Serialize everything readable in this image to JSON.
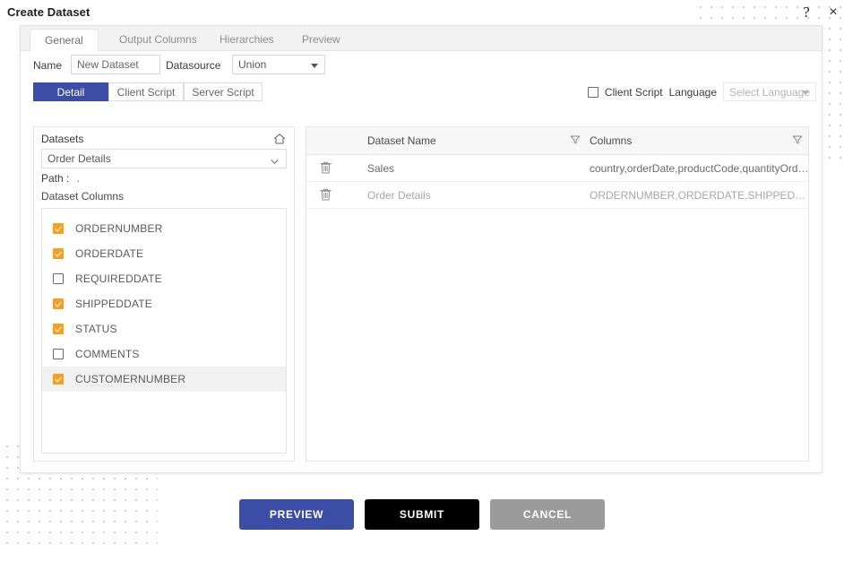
{
  "window": {
    "title": "Create Dataset",
    "help_icon": "question-mark-icon",
    "help_label": "?",
    "close_label": "×"
  },
  "colors": {
    "accent_blue": "#3b4da4",
    "checkbox_orange": "#f5a020",
    "submit_black": "#000000",
    "cancel_gray": "#9b9b9b",
    "dot_pattern": "#c9c9e8"
  },
  "tabs": [
    {
      "label": "General",
      "active": true
    },
    {
      "label": "Output Columns",
      "active": false
    },
    {
      "label": "Hierarchies",
      "active": false
    },
    {
      "label": "Preview",
      "active": false
    }
  ],
  "fields": {
    "name_label": "Name",
    "name_value": "New Dataset",
    "name_placeholder": "New Dataset",
    "datasource_label": "Datasource",
    "datasource_value": "Union"
  },
  "subtabs": [
    {
      "label": "Detail",
      "active": true
    },
    {
      "label": "Client Script",
      "active": false
    },
    {
      "label": "Server Script",
      "active": false
    }
  ],
  "script_options": {
    "client_script_checked": false,
    "client_script_label": "Client Script",
    "language_label": "Language",
    "language_value": "Select Language"
  },
  "left_panel": {
    "datasets_label": "Datasets",
    "home_icon": "home-icon",
    "selected_dataset": "Order Details",
    "path_label": "Path :",
    "path_value": ".",
    "dataset_columns_label": "Dataset Columns",
    "columns": [
      {
        "name": "ORDERNUMBER",
        "checked": true,
        "selected": false
      },
      {
        "name": "ORDERDATE",
        "checked": true,
        "selected": false
      },
      {
        "name": "REQUIREDDATE",
        "checked": false,
        "selected": false
      },
      {
        "name": "SHIPPEDDATE",
        "checked": true,
        "selected": false
      },
      {
        "name": "STATUS",
        "checked": true,
        "selected": false
      },
      {
        "name": "COMMENTS",
        "checked": false,
        "selected": false
      },
      {
        "name": "CUSTOMERNUMBER",
        "checked": true,
        "selected": true
      }
    ]
  },
  "right_panel": {
    "headers": {
      "dataset_name": "Dataset Name",
      "columns": "Columns"
    },
    "rows": [
      {
        "dataset_name": "Sales",
        "columns": "country,orderDate,productCode,quantityOrdered..."
      },
      {
        "dataset_name": "Order Details",
        "columns": "ORDERNUMBER,ORDERDATE,SHIPPEDDAT..."
      }
    ]
  },
  "footer": {
    "preview_label": "PREVIEW",
    "submit_label": "SUBMIT",
    "cancel_label": "CANCEL"
  }
}
